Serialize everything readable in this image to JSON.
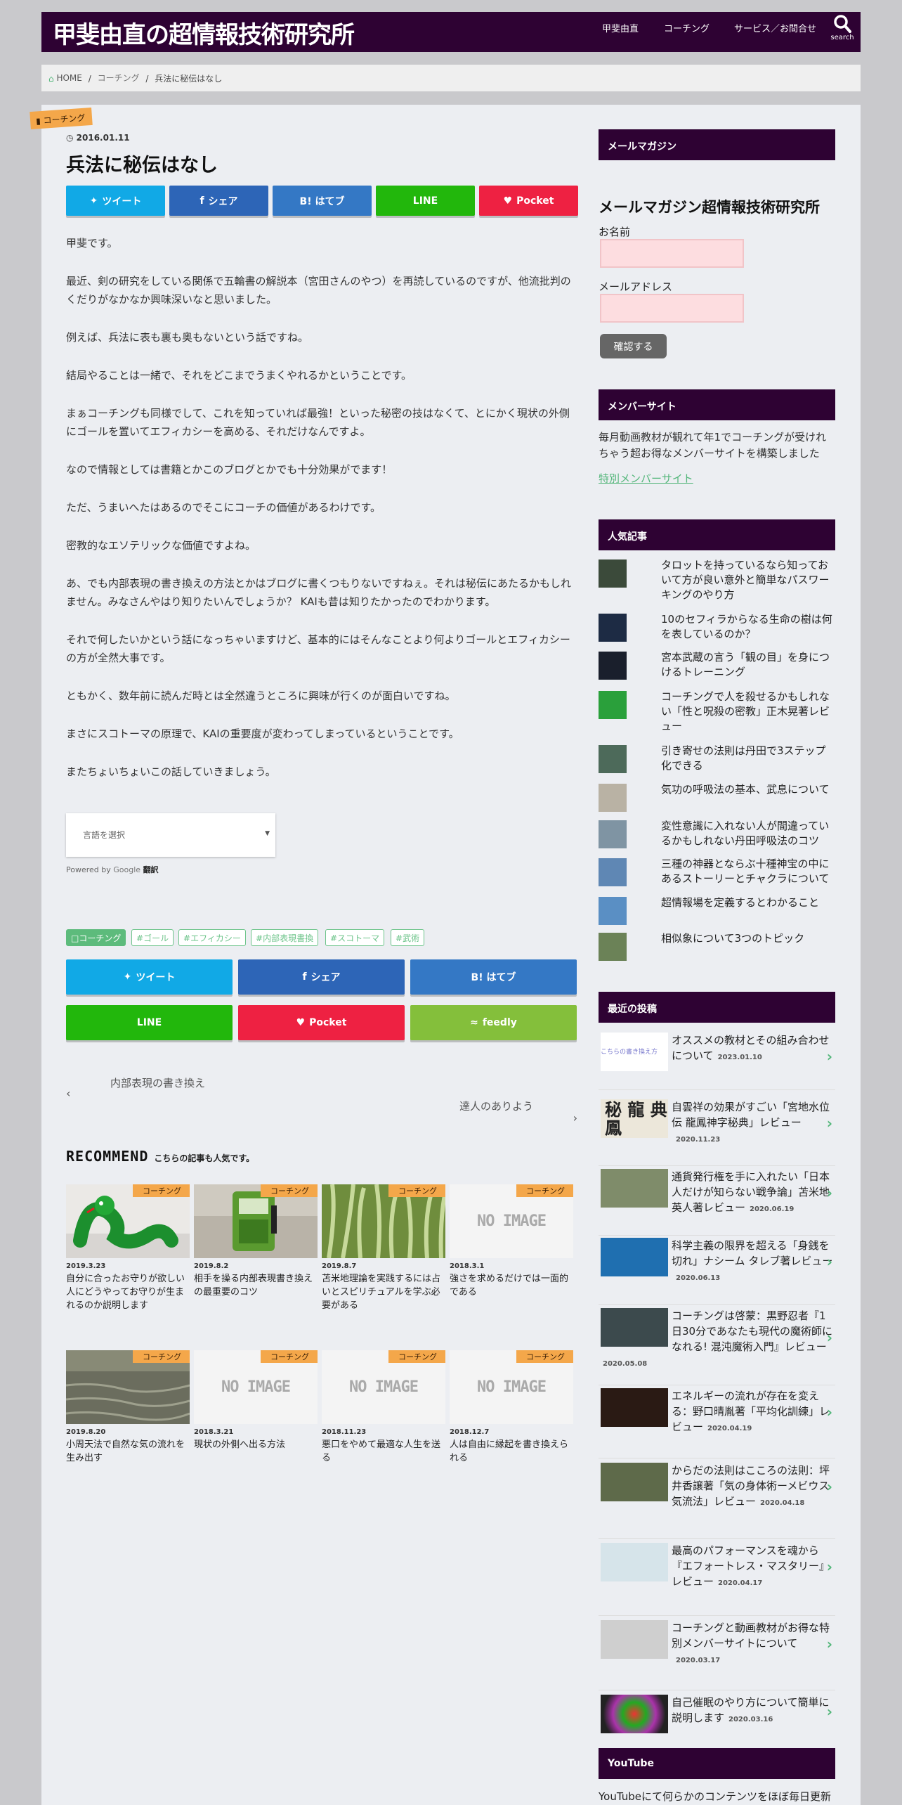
{
  "header": {
    "title": "甲斐由直の超情報技術研究所",
    "nav": [
      "甲斐由直",
      "コーチング",
      "サービス／お問合せ"
    ],
    "search_label": "search"
  },
  "breadcrumb": [
    "HOME",
    "コーチング",
    "兵法に秘伝はなし"
  ],
  "post": {
    "category": "コーチング",
    "date": "2016.01.11",
    "title": "兵法に秘伝はなし",
    "paragraphs": [
      "甲斐です。",
      "最近、剣の研究をしている関係で五輪書の解説本（宮田さんのやつ）を再読しているのですが、他流批判のくだりがなかなか興味深いなと思いました。",
      "例えば、兵法に表も裏も奥もないという話ですね。",
      "結局やることは一緒で、それをどこまでうまくやれるかということです。",
      "まぁコーチングも同様でして、これを知っていれば最強！といった秘密の技はなくて、とにかく現状の外側にゴールを置いてエフィカシーを高める、それだけなんですよ。",
      "なので情報としては書籍とかこのブログとかでも十分効果がでます！",
      "ただ、うまいへたはあるのでそこにコーチの価値があるわけです。",
      "密教的なエソテリックな価値ですよね。",
      "あ、でも内部表現の書き換えの方法とかはブログに書くつもりないですねぇ。それは秘伝にあたるかもしれません。みなさんやはり知りたいんでしょうか？ KAIも昔は知りたかったのでわかります。",
      "それで何したいかという話になっちゃいますけど、基本的にはそんなことより何よりゴールとエフィカシーの方が全然大事です。",
      "ともかく、数年前に読んだ時とは全然違うところに興味が行くのが面白いですね。",
      "まさにスコトーマの原理で、KAIの重要度が変わってしまっているということです。",
      "またちょいちょいこの話していきましょう。"
    ]
  },
  "share_top": {
    "tweet": "ツイート",
    "share": "シェア",
    "hatebu": "B! はてブ",
    "line": "LINE",
    "pocket": "Pocket"
  },
  "share_bottom": {
    "tweet": "ツイート",
    "share": "シェア",
    "hatebu": "B! はてブ",
    "line": "LINE",
    "pocket": "Pocket",
    "feedly": "feedly"
  },
  "translate": {
    "select": "言語を選択",
    "powered": "Powered by",
    "google": "Google",
    "translate": "翻訳"
  },
  "tags": {
    "category": "コーチング",
    "items": [
      "ゴール",
      "エフィカシー",
      "内部表現書換",
      "スコトーマ",
      "武術"
    ]
  },
  "post_nav": {
    "prev": "内部表現の書き換え",
    "next": "達人のありよう"
  },
  "recommend": {
    "title": "RECOMMEND",
    "subtitle": "こちらの記事も人気です。",
    "noimage": "NO IMAGE",
    "items": [
      {
        "badge": "コーチング",
        "date": "2019.3.23",
        "title": "自分に合ったお守りが欲しい人にどうやってお守りが生まれるのか説明します"
      },
      {
        "badge": "コーチング",
        "date": "2019.8.2",
        "title": "相手を操る内部表現書き換えの最重要のコツ"
      },
      {
        "badge": "コーチング",
        "date": "2019.8.7",
        "title": "苫米地理論を実践するには占いとスピリチュアルを学ぶ必要がある"
      },
      {
        "badge": "コーチング",
        "date": "2018.3.1",
        "title": "強さを求めるだけでは一面的である"
      },
      {
        "badge": "コーチング",
        "date": "2019.8.20",
        "title": "小周天法で自然な気の流れを生み出す"
      },
      {
        "badge": "コーチング",
        "date": "2018.3.21",
        "title": "現状の外側へ出る方法"
      },
      {
        "badge": "コーチング",
        "date": "2018.11.23",
        "title": "悪口をやめて最適な人生を送る"
      },
      {
        "badge": "コーチング",
        "date": "2018.12.7",
        "title": "人は自由に縁起を書き換えられる"
      }
    ]
  },
  "sidebar": {
    "newsletter": {
      "head": "メールマガジン",
      "title": "メールマガジン超情報技術研究所",
      "name_label": "お名前",
      "email_label": "メールアドレス",
      "submit": "確認する"
    },
    "member": {
      "head": "メンバーサイト",
      "text": "毎月動画教材が観れて年1でコーチングが受けれちゃう超お得なメンバーサイトを構築しました",
      "link": "特別メンバーサイト"
    },
    "popular": {
      "head": "人気記事",
      "items": [
        "タロットを持っているなら知っておいて方が良い意外と簡単なパスワーキングのやり方",
        "10のセフィラからなる生命の樹は何を表しているのか？",
        "宮本武蔵の言う「観の目」を身につけるトレーニング",
        "コーチングで人を殺せるかもしれない「性と呪殺の密教」正木晃著レビュー",
        "引き寄せの法則は丹田で3ステップ化できる",
        "気功の呼吸法の基本、武息について",
        "変性意識に入れない人が間違っているかもしれない丹田呼吸法のコツ",
        "三種の神器とならぶ十種神宝の中にあるストーリーとチャクラについて",
        "超情報場を定義するとわかること",
        "相似象について3つのトピック"
      ]
    },
    "recent": {
      "head": "最近の投稿",
      "items": [
        {
          "title": "オススメの教材とその組み合わせについて",
          "date": "2023.01.10",
          "thumb_text": "こちらの書き換え方"
        },
        {
          "title": "自雲祥の効果がすごい「宮地水位伝 龍鳳神字秘典」レビュー",
          "date": "2020.11.23",
          "thumb_text": "秘 龍 典 鳳"
        },
        {
          "title": "通貨発行権を手に入れたい「日本人だけが知らない戦争論」苫米地英人著レビュー",
          "date": "2020.06.19",
          "thumb_text": ""
        },
        {
          "title": "科学主義の限界を超える「身銭を切れ」ナシーム タレブ著レビュー",
          "date": "2020.06.13",
          "thumb_text": ""
        },
        {
          "title": "コーチングは啓蒙：黒野忍者『1日30分であなたも現代の魔術師になれる! 混沌魔術入門』レビュー",
          "date": "2020.05.08",
          "thumb_text": ""
        },
        {
          "title": "エネルギーの流れが存在を変える：野口晴胤著「平均化訓練」レビュー",
          "date": "2020.04.19",
          "thumb_text": ""
        },
        {
          "title": "からだの法則はこころの法則：坪井香譲著「気の身体術ーメビウス気流法」レビュー",
          "date": "2020.04.18",
          "thumb_text": ""
        },
        {
          "title": "最高のパフォーマンスを魂から『エフォートレス・マスタリー』レビュー",
          "date": "2020.04.17",
          "thumb_text": ""
        },
        {
          "title": "コーチングと動画教材がお得な特別メンバーサイトについて",
          "date": "2020.03.17",
          "thumb_text": ""
        },
        {
          "title": "自己催眠のやり方について簡単に説明します",
          "date": "2020.03.16",
          "thumb_text": ""
        }
      ]
    },
    "youtube": {
      "head": "YouTube",
      "text": "YouTubeにて何らかのコンテンツをほぼ毎日更新"
    }
  },
  "colors": {
    "header_bg": "#2e0233",
    "accent_green": "#53b67a",
    "ribbon_orange": "#f4a74a"
  }
}
